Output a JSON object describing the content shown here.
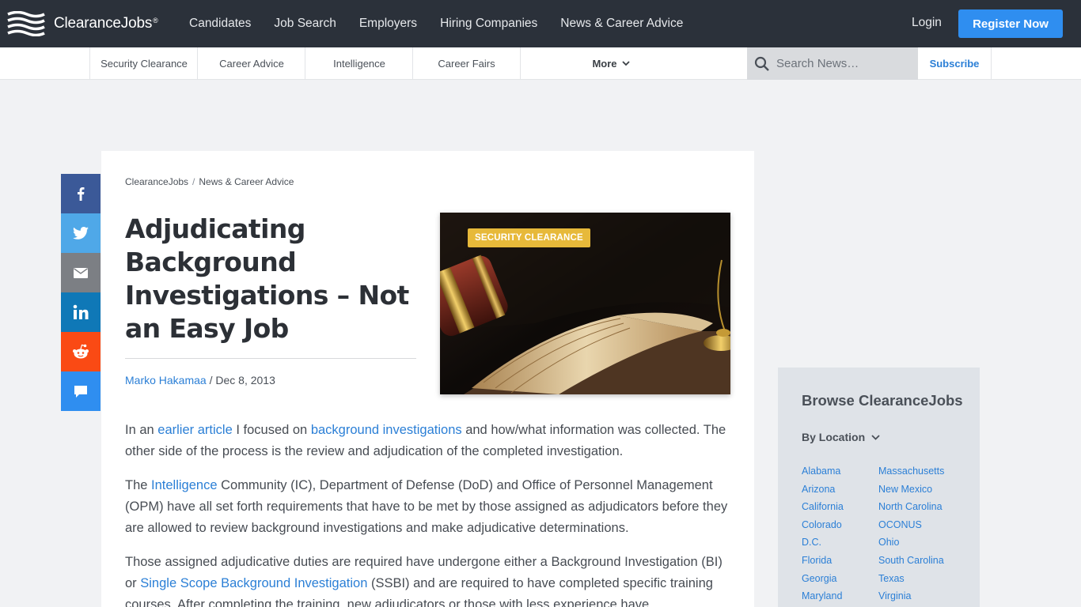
{
  "brand": {
    "name": "ClearanceJobs",
    "trademark": "®"
  },
  "nav": {
    "links": [
      "Candidates",
      "Job Search",
      "Employers",
      "Hiring Companies",
      "News & Career Advice"
    ],
    "login": "Login",
    "register": "Register Now"
  },
  "subnav": {
    "items": [
      "Security Clearance",
      "Career Advice",
      "Intelligence",
      "Career Fairs"
    ],
    "more": "More",
    "search_placeholder": "Search News…",
    "subscribe": "Subscribe"
  },
  "social": [
    {
      "name": "facebook",
      "color": "#3b5998"
    },
    {
      "name": "twitter",
      "color": "#4fa8e8"
    },
    {
      "name": "email",
      "color": "#7c7f84"
    },
    {
      "name": "linkedin",
      "color": "#0f78b7"
    },
    {
      "name": "reddit",
      "color": "#fa4a14"
    },
    {
      "name": "comment",
      "color": "#2f8ef0"
    }
  ],
  "breadcrumb": {
    "home": "ClearanceJobs",
    "section": "News & Career Advice",
    "separator": "/"
  },
  "article": {
    "title": "Adjudicating Background Investigations – Not an Easy Job",
    "author": "Marko Hakamaa",
    "date_sep": " / ",
    "date": "Dec 8, 2013",
    "tag": "SECURITY CLEARANCE",
    "p1": {
      "a": "In an ",
      "link1": "earlier article",
      "b": " I focused on ",
      "link2": "background investigations",
      "c": " and how/what information was collected. The other side of the process is the review and adjudication of the completed investigation."
    },
    "p2": {
      "a": "The ",
      "link1": "Intelligence",
      "b": " Community (IC), Department of Defense (DoD) and Office of Personnel Management (OPM) have all set forth requirements that have to be met by those assigned as adjudicators before they are allowed to review background investigations and make adjudicative determinations."
    },
    "p3": {
      "a": "Those assigned adjudicative duties are required have undergone either a Background Investigation (BI) or ",
      "link1": "Single Scope Background Investigation",
      "b": " (SSBI) and are required to have completed specific training courses.  After completing the training, new adjudicators or those with less experience have"
    }
  },
  "browse": {
    "title": "Browse ClearanceJobs",
    "filter": "By Location",
    "col1": [
      "Alabama",
      "Arizona",
      "California",
      "Colorado",
      "D.C.",
      "Florida",
      "Georgia",
      "Maryland"
    ],
    "col2": [
      "Massachusetts",
      "New Mexico",
      "North Carolina",
      "OCONUS",
      "Ohio",
      "South Carolina",
      "Texas",
      "Virginia"
    ]
  }
}
